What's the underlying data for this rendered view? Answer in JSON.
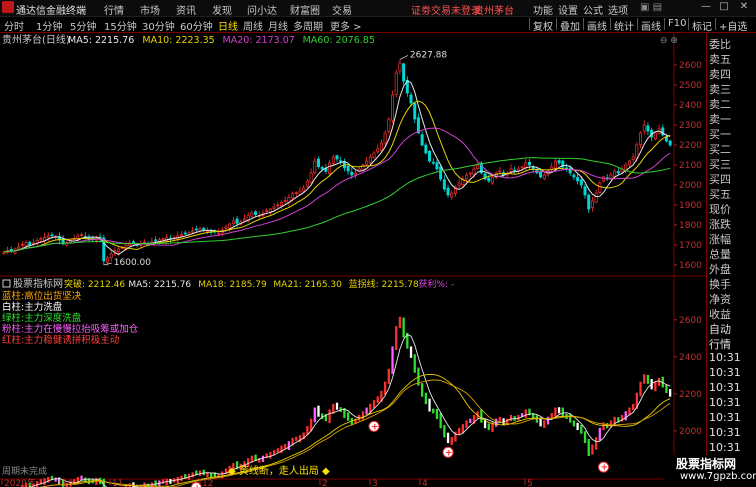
{
  "titlebar": {
    "app": "通达信金融终端",
    "menus": [
      "行情",
      "市场",
      "资讯",
      "发现",
      "问小达",
      "财富圈",
      "交易"
    ],
    "notice": "证劵交易未登录",
    "stock": "贵州茅台",
    "right_menus": [
      "功能",
      "设置",
      "公式",
      "选项"
    ],
    "win_btns": [
      "—",
      "□",
      "✕"
    ]
  },
  "toolbar": {
    "periods": [
      "分时",
      "1分钟",
      "5分钟",
      "15分钟",
      "30分钟",
      "60分钟",
      "日线",
      "周线",
      "月线",
      "多周期",
      "更多 >"
    ],
    "active": "日线",
    "right_buttons": [
      "复权",
      "叠加",
      "画线",
      "统计",
      "画线",
      "F10",
      "标记",
      "+自选"
    ]
  },
  "upper": {
    "label": "贵州茅台(日线)",
    "ma": [
      {
        "text": "MA5: 2215.76",
        "color": "#e8e8e8"
      },
      {
        "text": "MA10: 2223.35",
        "color": "#e6d200"
      },
      {
        "text": "MA20: 2173.07",
        "color": "#d040d0"
      },
      {
        "text": "MA60: 2076.85",
        "color": "#30d030"
      }
    ],
    "ylim": [
      1560,
      2700
    ],
    "yticks": [
      1600,
      1700,
      1800,
      1900,
      2000,
      2100,
      2200,
      2300,
      2400,
      2500,
      2600
    ],
    "high_label": "2627.88",
    "low_label": "1600.00"
  },
  "lower": {
    "label": "股票指标网",
    "indicators": [
      {
        "text": "突破: 2212.46",
        "color": "#e6d200"
      },
      {
        "text": "MA5: 2215.76",
        "color": "#e8e8e8"
      },
      {
        "text": "MA18: 2185.79",
        "color": "#e6d200"
      },
      {
        "text": "MA21: 2165.30",
        "color": "#e6d200"
      },
      {
        "text": "蓝拐线: 2215.78",
        "color": "#e6d200"
      },
      {
        "text": "获利%: -",
        "color": "#e040e0"
      }
    ],
    "legend": [
      {
        "text": "蓝柱:高位出货坚决",
        "color": "#ffa500"
      },
      {
        "text": "白柱:主力洗盘",
        "color": "#ffffff"
      },
      {
        "text": "绿柱:主力深度洗盘",
        "color": "#30e030"
      },
      {
        "text": "粉柱:主力在慢慢拉抬吸筹或加仓",
        "color": "#ff60ff"
      },
      {
        "text": "红柱:主力稳健诱拼积极主动",
        "color": "#ff4040"
      }
    ],
    "ylim": [
      1740,
      2680
    ],
    "yticks": [
      1800,
      2000,
      2200,
      2400,
      2600
    ],
    "signal_text": "◆ 黄线断，走人出局 ◆",
    "bottom_left": "周期未完成"
  },
  "xaxis": {
    "labels": [
      "2020年",
      "10",
      "11",
      "12",
      "2",
      "3",
      "4",
      "5"
    ]
  },
  "rightpanel": {
    "items": [
      "委比",
      "卖五",
      "卖四",
      "卖三",
      "卖二",
      "卖一",
      "买一",
      "买二",
      "买三",
      "买四",
      "买五",
      "现价",
      "涨跌",
      "涨幅",
      "总量",
      "外盘",
      "换手",
      "净资",
      "收益",
      "自动",
      "行情",
      "10:31",
      "10:31",
      "10:31",
      "10:31",
      "10:31",
      "10:31",
      "10:31"
    ]
  },
  "watermark": {
    "line1": "股票指标网",
    "line2": "www.7gpzb.com"
  },
  "chart_data": {
    "type": "candlestick",
    "series": [
      {
        "name": "MA5",
        "values": []
      },
      {
        "name": "MA10",
        "values": []
      },
      {
        "name": "MA20",
        "values": []
      },
      {
        "name": "MA60",
        "values": []
      }
    ],
    "close": [
      1665,
      1672,
      1668,
      1680,
      1690,
      1702,
      1712,
      1698,
      1710,
      1722,
      1732,
      1738,
      1745,
      1750,
      1742,
      1725,
      1705,
      1712,
      1722,
      1733,
      1745,
      1752,
      1740,
      1728,
      1732,
      1740,
      1728,
      1620,
      1635,
      1655,
      1672,
      1680,
      1688,
      1698,
      1710,
      1712,
      1698,
      1705,
      1715,
      1708,
      1716,
      1720,
      1726,
      1732,
      1736,
      1730,
      1738,
      1745,
      1752,
      1757,
      1762,
      1770,
      1775,
      1780,
      1776,
      1770,
      1764,
      1768,
      1760,
      1775,
      1790,
      1805,
      1820,
      1808,
      1816,
      1830,
      1846,
      1860,
      1852,
      1848,
      1860,
      1872,
      1880,
      1890,
      1900,
      1914,
      1922,
      1938,
      1956,
      1962,
      1970,
      1985,
      2020,
      2060,
      2120,
      2092,
      2080,
      2068,
      2110,
      2140,
      2130,
      2118,
      2086,
      2070,
      2050,
      2060,
      2080,
      2100,
      2120,
      2140,
      2160,
      2180,
      2210,
      2260,
      2330,
      2450,
      2560,
      2610,
      2520,
      2460,
      2410,
      2330,
      2260,
      2200,
      2160,
      2120,
      2110,
      2080,
      2030,
      1980,
      1950,
      1960,
      1990,
      2010,
      2030,
      2050,
      2060,
      2080,
      2100,
      2060,
      2030,
      2020,
      2040,
      2060,
      2070,
      2050,
      2060,
      2080,
      2070,
      2080,
      2090,
      2110,
      2100,
      2080,
      2060,
      2040,
      2050,
      2070,
      2090,
      2120,
      2110,
      2090,
      2080,
      2060,
      2040,
      2020,
      2000,
      1950,
      1880,
      1920,
      1960,
      2010,
      2040,
      2030,
      2050,
      2070,
      2060,
      2080,
      2100,
      2120,
      2140,
      2200,
      2260,
      2300,
      2270,
      2240,
      2260,
      2280,
      2250,
      2220,
      2200
    ],
    "notes": "approximate daily closes read from the screenshot; high 2627.88, low 1600.00"
  }
}
